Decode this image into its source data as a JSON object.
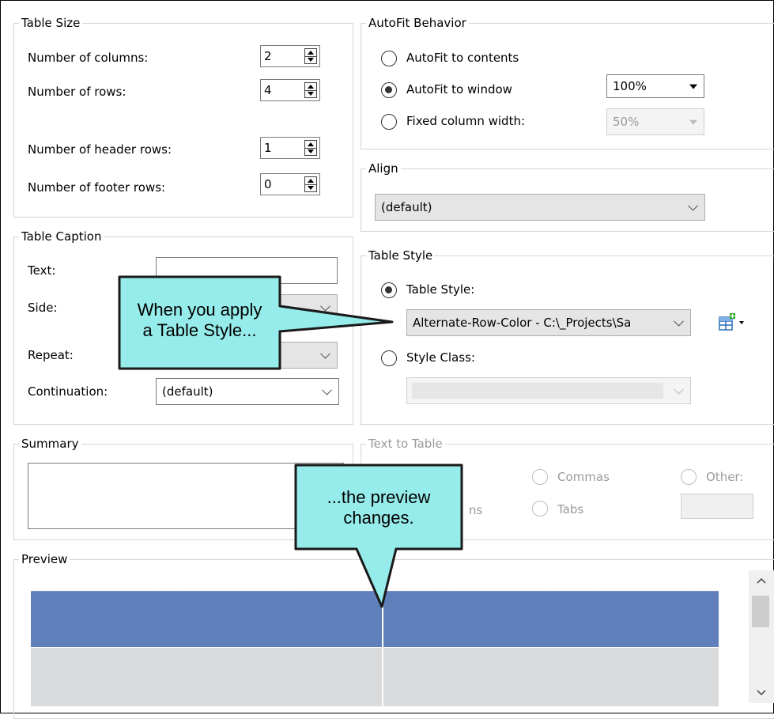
{
  "table_size": {
    "legend": "Table Size",
    "columns_label": "Number of columns:",
    "columns_value": "2",
    "rows_label": "Number of rows:",
    "rows_value": "4",
    "header_rows_label": "Number of header rows:",
    "header_rows_value": "1",
    "footer_rows_label": "Number of footer rows:",
    "footer_rows_value": "0"
  },
  "autofit": {
    "legend": "AutoFit Behavior",
    "contents_label": "AutoFit to contents",
    "window_label": "AutoFit to window",
    "window_value": "100%",
    "fixed_label": "Fixed column width:",
    "fixed_value": "50%"
  },
  "align": {
    "legend": "Align",
    "value": "(default)"
  },
  "table_caption": {
    "legend": "Table Caption",
    "text_label": "Text:",
    "side_label": "Side:",
    "repeat_label": "Repeat:",
    "continuation_label": "Continuation:",
    "continuation_value": "(default)"
  },
  "table_style": {
    "legend": "Table Style",
    "style_radio_label": "Table Style:",
    "style_value": "Alternate-Row-Color - C:\\_Projects\\Sa",
    "class_radio_label": "Style Class:"
  },
  "summary": {
    "legend": "Summary"
  },
  "text_to_table": {
    "legend": "Text to Table",
    "commas_label": "Commas",
    "other_label": "Other:",
    "partial_label": "ns",
    "tabs_label": "Tabs"
  },
  "preview": {
    "legend": "Preview"
  },
  "callouts": {
    "style_line1": "When you apply",
    "style_line2": "a Table Style...",
    "preview_line1": "...the preview",
    "preview_line2": "changes."
  },
  "colors": {
    "callout_fill": "#96ECEA",
    "preview_header": "#6080BC",
    "preview_row": "#D9DADC"
  }
}
